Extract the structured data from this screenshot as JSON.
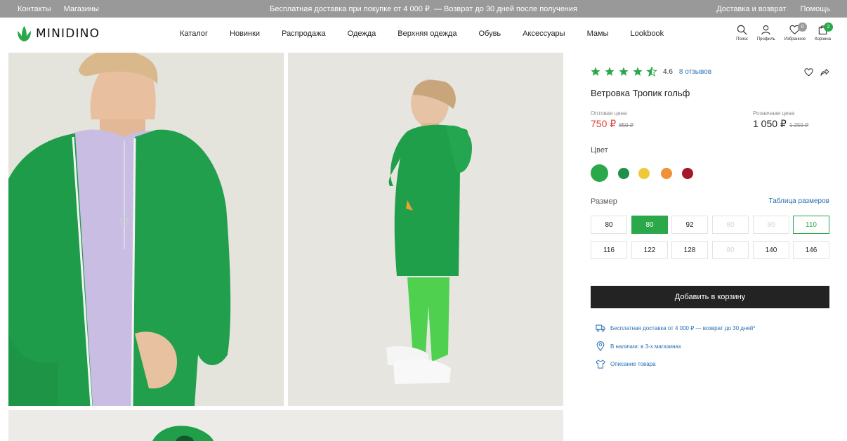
{
  "topbar": {
    "left": [
      "Контакты",
      "Магазины"
    ],
    "center": "Бесплатная доставка при покупке от 4 000 ₽. — Возврат до 30 дней после получения",
    "right": [
      "Доставка и возврат",
      "Помощь"
    ]
  },
  "logo": "MINIDINO",
  "nav": [
    "Каталог",
    "Новинки",
    "Распродажа",
    "Одежда",
    "Верхняя одежда",
    "Обувь",
    "Аксессуары",
    "Мамы",
    "Lookbook"
  ],
  "header_icons": [
    {
      "label": "Поиск",
      "icon": "search-icon"
    },
    {
      "label": "Профиль",
      "icon": "user-icon"
    },
    {
      "label": "Избранное",
      "icon": "heart-icon",
      "badge": "0"
    },
    {
      "label": "Корзина",
      "icon": "bag-icon",
      "badge": "2"
    }
  ],
  "product": {
    "rating": "4.6",
    "rating_value": 4.6,
    "reviews": "8 отзывов",
    "title": "Ветровка Тропик гольф",
    "wholesale_label": "Оптовая цена",
    "wholesale_price": "750 ₽",
    "wholesale_old": "850 ₽",
    "retail_label": "Розничная цена",
    "retail_price": "1 050 ₽",
    "retail_old": "1 250 ₽",
    "color_label": "Цвет",
    "colors": [
      "#2ba84a",
      "#1f8f4a",
      "#f0c93a",
      "#f0913a",
      "#a3182b"
    ],
    "size_label": "Размер",
    "size_table": "Таблица размеров",
    "sizes": [
      {
        "v": "80",
        "s": ""
      },
      {
        "v": "80",
        "s": "selected"
      },
      {
        "v": "92",
        "s": ""
      },
      {
        "v": "80",
        "s": "disabled"
      },
      {
        "v": "80",
        "s": "disabled"
      },
      {
        "v": "110",
        "s": "outlined"
      },
      {
        "v": "116",
        "s": ""
      },
      {
        "v": "122",
        "s": ""
      },
      {
        "v": "128",
        "s": ""
      },
      {
        "v": "80",
        "s": "disabled"
      },
      {
        "v": "140",
        "s": ""
      },
      {
        "v": "146",
        "s": ""
      }
    ],
    "add_to_cart": "Добавить в корзину",
    "info": [
      "Бесплатная доставка от 4 000 ₽ — возврат до 30 дней*",
      "В наличии: в 3-х магазинах",
      "Описание товара"
    ]
  },
  "colors": {
    "accent": "#2ba84a",
    "link": "#2a6fb3",
    "price": "#e2403e",
    "badge_gray": "#9a9a9a"
  }
}
